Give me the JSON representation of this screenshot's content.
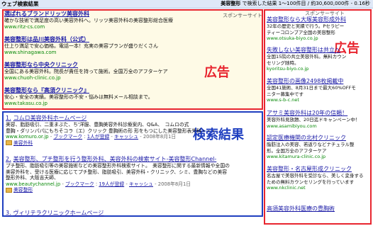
{
  "header": {
    "title": "ウェブ検索結果",
    "query_prefix": "美容整形",
    "query_suffix": " で検索した結果 1～100件目 / 約30,600,000件 - 0.16秒"
  },
  "labels": {
    "ads": "広告",
    "ads_right": "広告",
    "results": "検索結果",
    "sponsor": "スポンサーサイト",
    "sponsor_right": "スポンサーサイト"
  },
  "top_ads": [
    {
      "title": "選ばれるブランドリッツ美容外科",
      "desc": "確かな技術で満足度の高い美容外科へ。リッツ美容外科の美容整形総合医療",
      "url": "www.ritz-cs.com"
    },
    {
      "title": "美容整形は品川美容外科（公式）",
      "desc": "仕上り満足で安心価格。電話一本！充実の美容プランが盛りだくさん",
      "url": "www.shinagawa.com"
    },
    {
      "title": "美容整形なら中央クリニック",
      "desc": "全国にある美容外科。院長が責任を持って施術。全国万全のアフターケア",
      "url": "www.chuoh-clinic.co.jp"
    },
    {
      "title": "美容整形なら『高須クリニック』",
      "desc": "安心・安全の実績。美容整形の不安・悩みは無料メール相談まで。",
      "url": "www.takasu.co.jp"
    }
  ],
  "right_ads": [
    {
      "title": "美容整形なら大塚美容形成外科",
      "desc": [
        "32年の歴史と実績で行う。Pセラピー",
        "ティーコロンブア全国の美容整形"
      ],
      "url": "www.otsuka-biyo.co.jp"
    },
    {
      "title": "失敗しない美容整形は共立へ",
      "desc": [
        "全国15院の共立美容外科。無料カウン",
        "セリング随時。"
      ],
      "url": "kyoritsu-biyo.co.jp"
    },
    {
      "title": "美容整形の画像2498枚掲載中",
      "desc": [
        "全国41施術、8月31日まで最大60%OFFモ",
        "ニター募集中です"
      ],
      "url": "www.s-b-c.net"
    },
    {
      "title": "アサミ美容外科は20年の信頼！",
      "desc": [
        "美容外科見放題、20日迄ドキャンペーン中！"
      ],
      "url": "www.asamibiyou.com"
    },
    {
      "title": "認定医療機関の北村クリニック",
      "desc": [
        "脂肪注入の美容、若返りなどナチュラル整",
        "形。全国万全のアフターケア"
      ],
      "url": "www.kitamura-clinic.co.jp"
    },
    {
      "title": "美容整形・名古屋形成クリニック",
      "desc": [
        "名古屋で美容外科を受診なら、美しく変身する",
        "ための無料カウンセリングを行っています"
      ],
      "url": "www.nkclinic.net"
    },
    {
      "title": "高須美容外科医療の豊胸術",
      "desc": [],
      "url": ""
    }
  ],
  "results": [
    {
      "num": "1.",
      "title": "コムロ美容外科ホームページ",
      "desc": [
        "美容、脂肪吸引、二重まぶた、ち'洋服、豊胸美容外科診療案内、Q&A、　コムロの式",
        "豊胸・ダリンパパにもちそコラ（エ）クリック 豊胸術の形 形をもつにした美容整形表外科・・・"
      ],
      "url": "www.komuro.or.jp",
      "bookmark": "ブックマーク",
      "count": "1人が登録",
      "cache": "キャッシュ",
      "date": "2008年8月1日",
      "category": "美容外科"
    },
    {
      "num": "2.",
      "title": "美容整形、プチ整形を行う整形外科、美容外科の検索サイト-美容整形Channel-",
      "desc": [
        "プチ整形、脂肪吸引等の美容施術などの美容整形外科検索サイト。　美容整形に関する最新情報や全国の",
        "美容外科を、受ける医療に応じてプチ整形、脂肪吸引、美容外科・クリニック、シミ、豊胸などの美容",
        "整形外科、大阪吉天師、　"
      ],
      "url": "www.beautychannel.jp",
      "bookmark": "ブックマーク",
      "count": "19人が登録",
      "cache": "キャッシュ",
      "date": "2008年8月1日",
      "category": "美容整形"
    },
    {
      "num": "3.",
      "title": "ヴィリテラクリニックホームページ",
      "desc": [],
      "url": "",
      "bookmark": "",
      "count": "",
      "cache": "",
      "date": "",
      "category": ""
    }
  ]
}
